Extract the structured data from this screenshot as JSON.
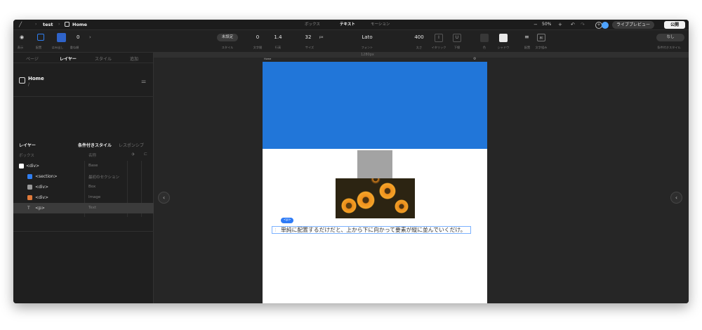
{
  "header": {
    "project": "test",
    "page": "Home",
    "mode_tabs": [
      "ボックス",
      "テキスト",
      "モーション"
    ],
    "active_mode": "テキスト",
    "zoom": "50%",
    "live_preview": "ライブプレビュー",
    "publish": "公開"
  },
  "toolbar": {
    "left_labels": [
      "表示",
      "配置",
      "はみ出し",
      "重ね順"
    ],
    "layer_count": "0",
    "style_value": "未設定",
    "style_label": "スタイル",
    "letter_spacing_value": "0",
    "letter_spacing_label": "文字間",
    "line_height_value": "1.4",
    "line_height_label": "行高",
    "size_value": "32",
    "size_unit": "px",
    "size_label": "サイズ",
    "font_value": "Lato",
    "font_label": "フォント",
    "weight_value": "400",
    "weight_label": "太さ",
    "italic_label": "イタリック",
    "underline_label": "下線",
    "color_label": "色",
    "shadow_label": "シャドウ",
    "align_label": "配置",
    "wrap_label": "文字組み",
    "cond_value": "なし",
    "cond_label": "条件付きスタイル"
  },
  "left_panel": {
    "tabs": [
      "ページ",
      "レイヤー",
      "スタイル",
      "追加"
    ],
    "active_tab": "レイヤー",
    "page_title": "Home",
    "page_path": "/",
    "layers_heading": "レイヤー",
    "cond_heading": "条件付きスタイル",
    "responsive_heading": "レスポンシブ",
    "col_box": "ボックス",
    "col_name": "名称",
    "rows": [
      {
        "tag": "<div>",
        "class": "Base",
        "color": "#ffffff"
      },
      {
        "tag": "<section>",
        "class": "最初のセクション",
        "color": "#2f7ef0"
      },
      {
        "tag": "<div>",
        "class": "Box",
        "color": "#9a9a9a"
      },
      {
        "tag": "<div>",
        "class": "Image",
        "color": "#e07a3a"
      },
      {
        "tag": "<p>",
        "class": "Text",
        "color": "#888888"
      }
    ]
  },
  "canvas": {
    "ruler_label": "1280px",
    "frame_title": "Home",
    "p_tag": "<p>",
    "paragraph": "単純に配置するだけだと、上から下に向かって要素が縦に並んでいくだけ。",
    "hero_color": "#2176d9"
  }
}
